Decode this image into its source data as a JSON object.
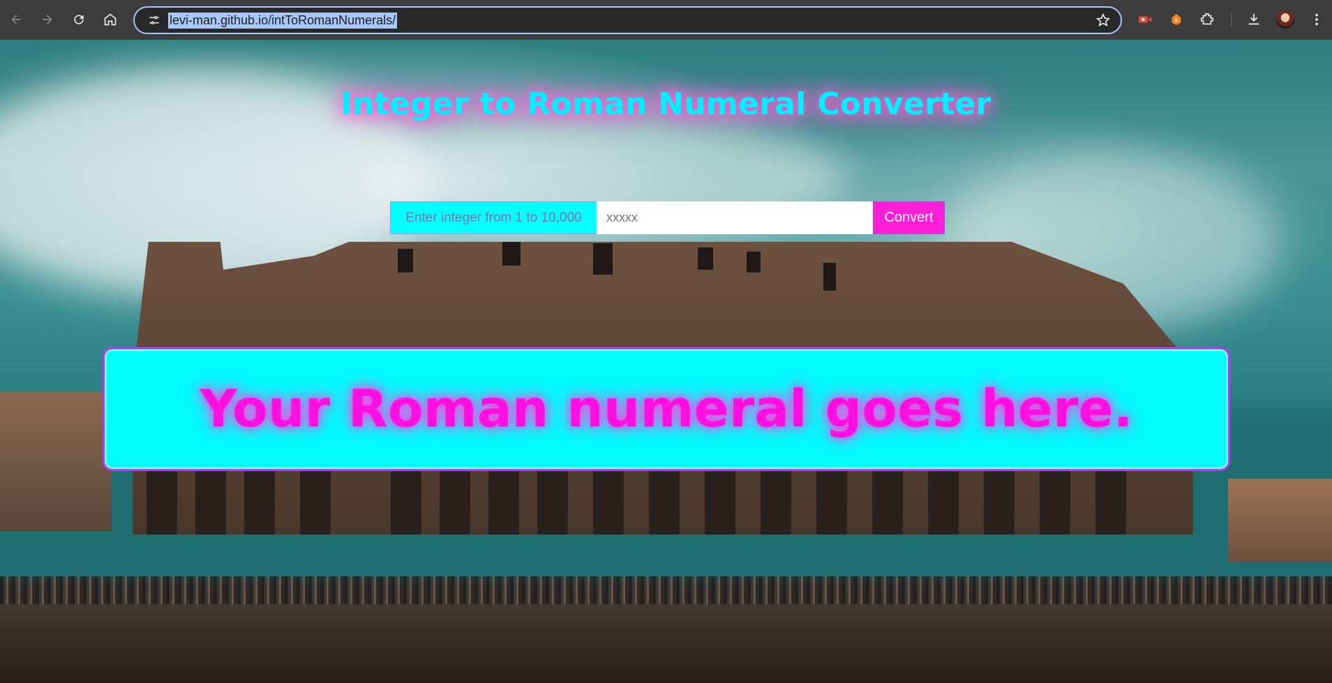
{
  "browser": {
    "url": "levi-man.github.io/intToRomanNumerals/",
    "icons": [
      "back-icon",
      "forward-icon",
      "reload-icon",
      "home-icon",
      "tune-icon",
      "star-icon",
      "extension-icon",
      "download-icon",
      "menu-icon"
    ]
  },
  "page": {
    "title": "Integer to Roman Numeral Converter",
    "form": {
      "label": "Enter integer from 1 to 10,000",
      "input_placeholder": "xxxxx",
      "input_value": "",
      "button_label": "Convert"
    },
    "result_text": "Your Roman numeral goes here.",
    "colors": {
      "accent_cyan": "#00ffff",
      "accent_magenta": "#ff1fd9",
      "border_purple": "#b23bf2"
    }
  }
}
